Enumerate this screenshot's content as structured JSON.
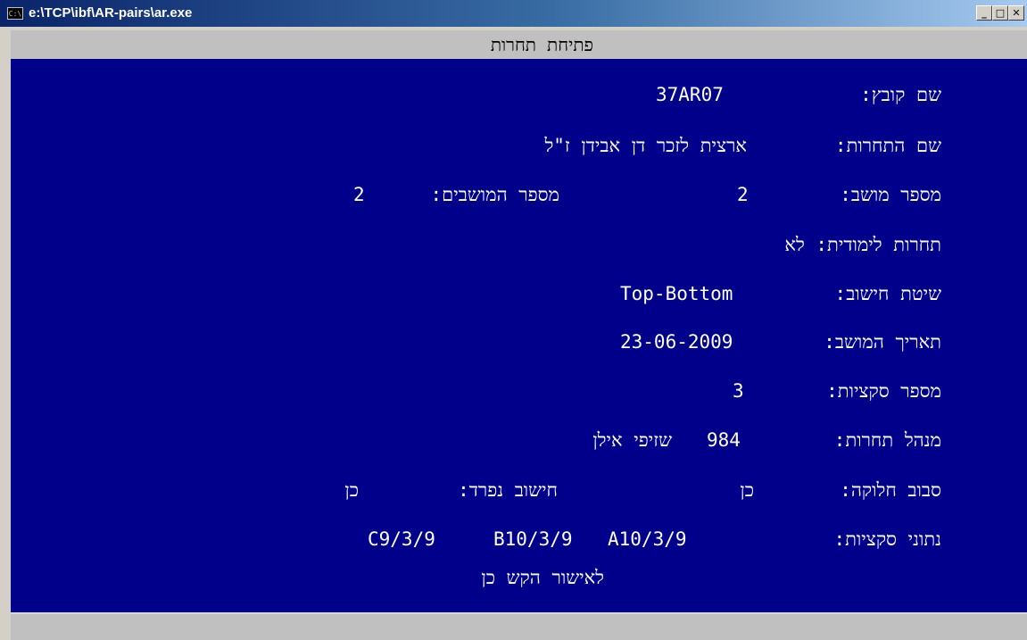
{
  "window": {
    "title": "e:\\TCP\\ibf\\AR-pairs\\ar.exe",
    "icon": "console-icon",
    "icon_text": "C:\\",
    "minimize": "_",
    "maximize": "□",
    "close": "✕"
  },
  "console": {
    "background": "#00008b",
    "text_color": "#ffffff",
    "bar_color": "#c0c0c0",
    "header": "פתיחת תחרות",
    "fields": {
      "file_name_label": "שם קובץ:",
      "file_name_value": "37AR07",
      "competition_name_label": "שם התחרות:",
      "competition_name_value": "ארצית לזכר דן אבידן ז\"ל",
      "session_number_label": "מספר מושב:",
      "session_number_value": "2",
      "sessions_count_label": "מספר המושבים:",
      "sessions_count_value": "2",
      "study_competition": "תחרות לימודית: לא",
      "calc_method_label": "שיטת חישוב:",
      "calc_method_value": "Top-Bottom",
      "session_date_label": "תאריך המושב:",
      "session_date_value": "23-06-2009",
      "sections_count_label": "מספר סקציות:",
      "sections_count_value": "3",
      "director_label": "מנהל תחרות:",
      "director_id": "984",
      "director_name": "שזיפי אילן",
      "rotation_label": "סבוב חלוקה:",
      "rotation_value": "כן",
      "separate_calc_label": "חישוב נפרד:",
      "separate_calc_value": "כן",
      "sections_data_label": "נתוני סקציות:",
      "section_a": "A10/3/9",
      "section_b": "B10/3/9",
      "section_c": "C9/3/9",
      "confirm_prompt": "לאישור הקש כן"
    }
  }
}
